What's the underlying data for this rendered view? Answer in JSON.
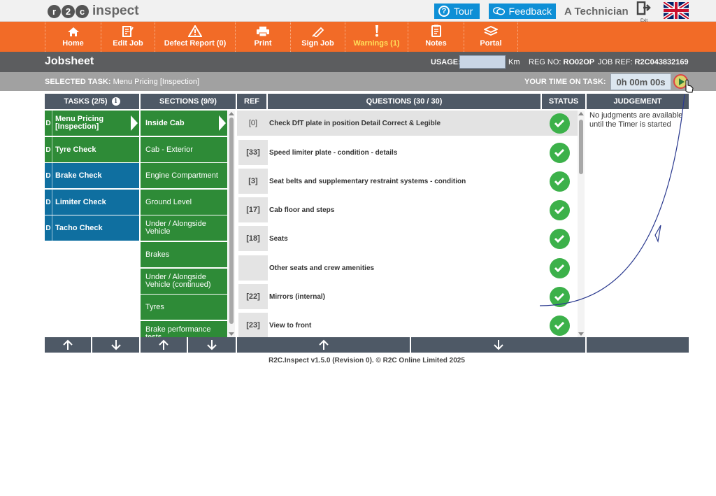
{
  "brand": {
    "logo_letters": "r2c",
    "logo_r": "r",
    "logo_2": "2",
    "logo_c": "c",
    "logo_word": "inspect"
  },
  "top": {
    "tour_label": "Tour",
    "feedback_label": "Feedback",
    "user_name": "A Technician",
    "exit_label": "Exit"
  },
  "nav": [
    {
      "label": "Home",
      "icon": "home-icon"
    },
    {
      "label": "Edit Job",
      "icon": "edit-icon"
    },
    {
      "label": "Defect Report (0)",
      "icon": "warning-triangle-icon"
    },
    {
      "label": "Print",
      "icon": "printer-icon"
    },
    {
      "label": "Sign Job",
      "icon": "pen-icon"
    },
    {
      "label": "Warnings (1)",
      "icon": "exclamation-icon",
      "highlight_color": "#ffe05a"
    },
    {
      "label": "Notes",
      "icon": "notes-icon"
    },
    {
      "label": "Portal",
      "icon": "layers-icon"
    }
  ],
  "jobbar": {
    "title": "Jobsheet",
    "usage_label": "USAGE:",
    "usage_value": "",
    "usage_unit": "Km",
    "reg_label": "REG NO:",
    "reg_value": "RO02OP",
    "jobref_label": "JOB REF:",
    "jobref_value": "R2C043832169"
  },
  "taskbar": {
    "selected_label": "SELECTED TASK:",
    "selected_value": "Menu Pricing [Inspection]",
    "time_label": "YOUR TIME ON TASK:",
    "time_value": "0h 00m 00s"
  },
  "headers": {
    "tasks": "TASKS (2/5)",
    "sections": "SECTIONS (9/9)",
    "ref": "REF",
    "questions": "QUESTIONS (30 / 30)",
    "status": "STATUS",
    "judgement": "JUDGEMENT"
  },
  "tasks": [
    {
      "flag": "D",
      "label": "Menu Pricing [Inspection]",
      "color": "#2e8b37",
      "selected": true
    },
    {
      "flag": "D",
      "label": "Tyre Check",
      "color": "#2e8b37"
    },
    {
      "flag": "D",
      "label": "Brake Check",
      "color": "#0f6fa0"
    },
    {
      "flag": "D",
      "label": "Limiter Check",
      "color": "#0f6fa0"
    },
    {
      "flag": "D",
      "label": "Tacho Check",
      "color": "#0f6fa0"
    }
  ],
  "sections": [
    {
      "label": "Inside Cab",
      "selected": true
    },
    {
      "label": "Cab - Exterior"
    },
    {
      "label": "Engine Compartment"
    },
    {
      "label": "Ground Level"
    },
    {
      "label": "Under / Alongside Vehicle"
    },
    {
      "label": "Brakes"
    },
    {
      "label": "Under / Alongside Vehicle (continued)"
    },
    {
      "label": "Tyres"
    },
    {
      "label": "Brake performance tests"
    }
  ],
  "questions": [
    {
      "ref": "[0]",
      "text": "Check DfT plate in position Detail Correct & Legible",
      "status": "pass",
      "highlight": true
    },
    {
      "ref": "[33]",
      "text": "Speed limiter plate - condition - details",
      "status": "pass"
    },
    {
      "ref": "[3]",
      "text": "Seat belts and supplementary restraint systems - condition",
      "status": "pass"
    },
    {
      "ref": "[17]",
      "text": "Cab floor and steps",
      "status": "pass"
    },
    {
      "ref": "[18]",
      "text": "Seats",
      "status": "pass"
    },
    {
      "ref": "",
      "text": "Other seats and crew amenities",
      "status": "pass"
    },
    {
      "ref": "[22]",
      "text": "Mirrors (internal)",
      "status": "pass"
    },
    {
      "ref": "[23]",
      "text": "View to front",
      "status": "pass"
    }
  ],
  "judgement_text": "No judgments are available until the Timer is started",
  "footer": "R2C.Inspect v1.5.0 (Revision 0). © R2C Online Limited 2025",
  "colors": {
    "orange": "#f26b27",
    "green": "#2e8b37",
    "blue": "#0f6fa0",
    "header": "#4e5966",
    "accent_blue": "#0e8fd6"
  }
}
